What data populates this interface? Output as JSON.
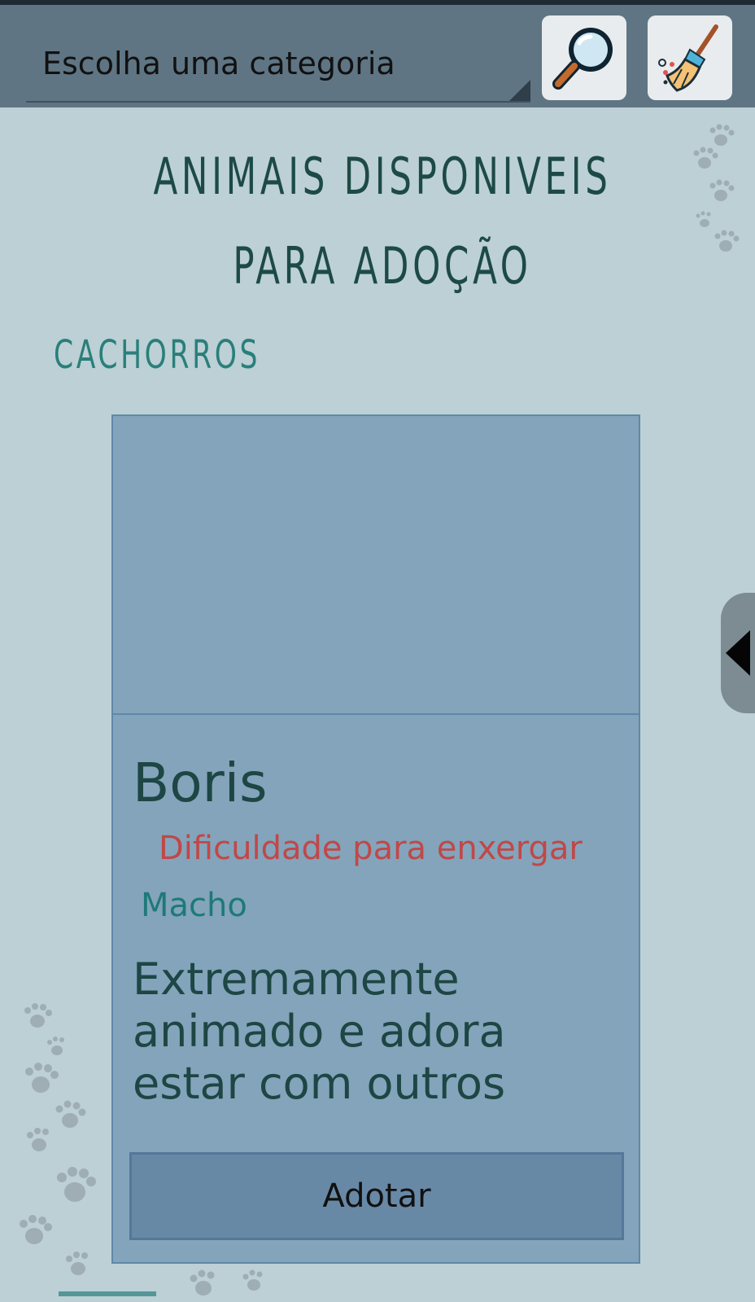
{
  "toolbar": {
    "category_placeholder": "Escolha uma categoria",
    "search_icon": "magnifier-icon",
    "clean_icon": "broom-icon"
  },
  "page": {
    "title": "ANIMAIS DISPONIVEIS PARA ADOÇÃO"
  },
  "section": {
    "heading": "CACHORROS"
  },
  "card": {
    "name": "Boris",
    "condition": "Dificuldade para enxergar",
    "sex": "Macho",
    "description": "Extremamente animado e adora estar com outros",
    "adopt_label": "Adotar"
  },
  "colors": {
    "background": "#bcd0d6",
    "toolbar": "#5f7584",
    "card": "#84a4bb",
    "title": "#1d4a44",
    "accent": "#2a7f7a",
    "condition": "#c04848",
    "button": "#6889a6"
  }
}
